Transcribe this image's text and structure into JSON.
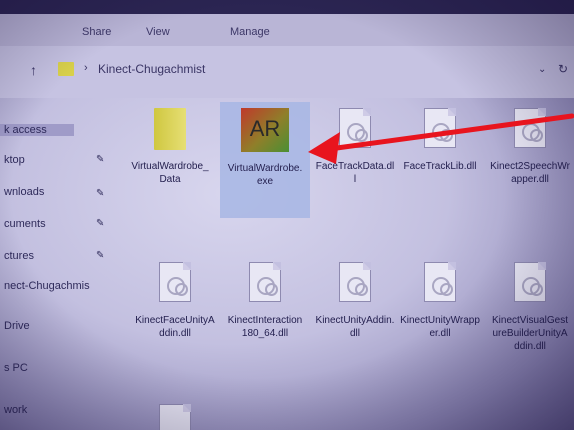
{
  "ribbon": {
    "tabs": [
      "Share",
      "View",
      "Manage"
    ]
  },
  "address": {
    "path": "Kinect-Chugachmist"
  },
  "nav": {
    "items": [
      {
        "label": "k access"
      },
      {
        "label": "ktop"
      },
      {
        "label": "wnloads"
      },
      {
        "label": "cuments"
      },
      {
        "label": "ctures"
      },
      {
        "label": "nect-Chugachmis"
      },
      {
        "label": "Drive"
      },
      {
        "label": "s PC"
      },
      {
        "label": "work"
      }
    ]
  },
  "files": [
    {
      "name": "VirtualWardrobe_Data",
      "icon": "folder-icon"
    },
    {
      "name": "VirtualWardrobe.exe",
      "icon": "ar-app-icon",
      "selected": true,
      "badge": "AR"
    },
    {
      "name": "FaceTrackData.dll",
      "icon": "dll-icon"
    },
    {
      "name": "FaceTrackLib.dll",
      "icon": "dll-icon"
    },
    {
      "name": "Kinect2SpeechWrapper.dll",
      "icon": "dll-icon"
    },
    {
      "name": "KinectFaceUnityAddin.dll",
      "icon": "dll-icon"
    },
    {
      "name": "KinectInteraction180_64.dll",
      "icon": "dll-icon"
    },
    {
      "name": "KinectUnityAddin.dll",
      "icon": "dll-icon"
    },
    {
      "name": "KinectUnityWrapper.dll",
      "icon": "dll-icon"
    },
    {
      "name": "KinectVisualGestureBuilderUnityAddin.dll",
      "icon": "dll-icon"
    }
  ],
  "colors": {
    "annotation_arrow": "#e8141e",
    "selection": "#a7b6e4"
  }
}
